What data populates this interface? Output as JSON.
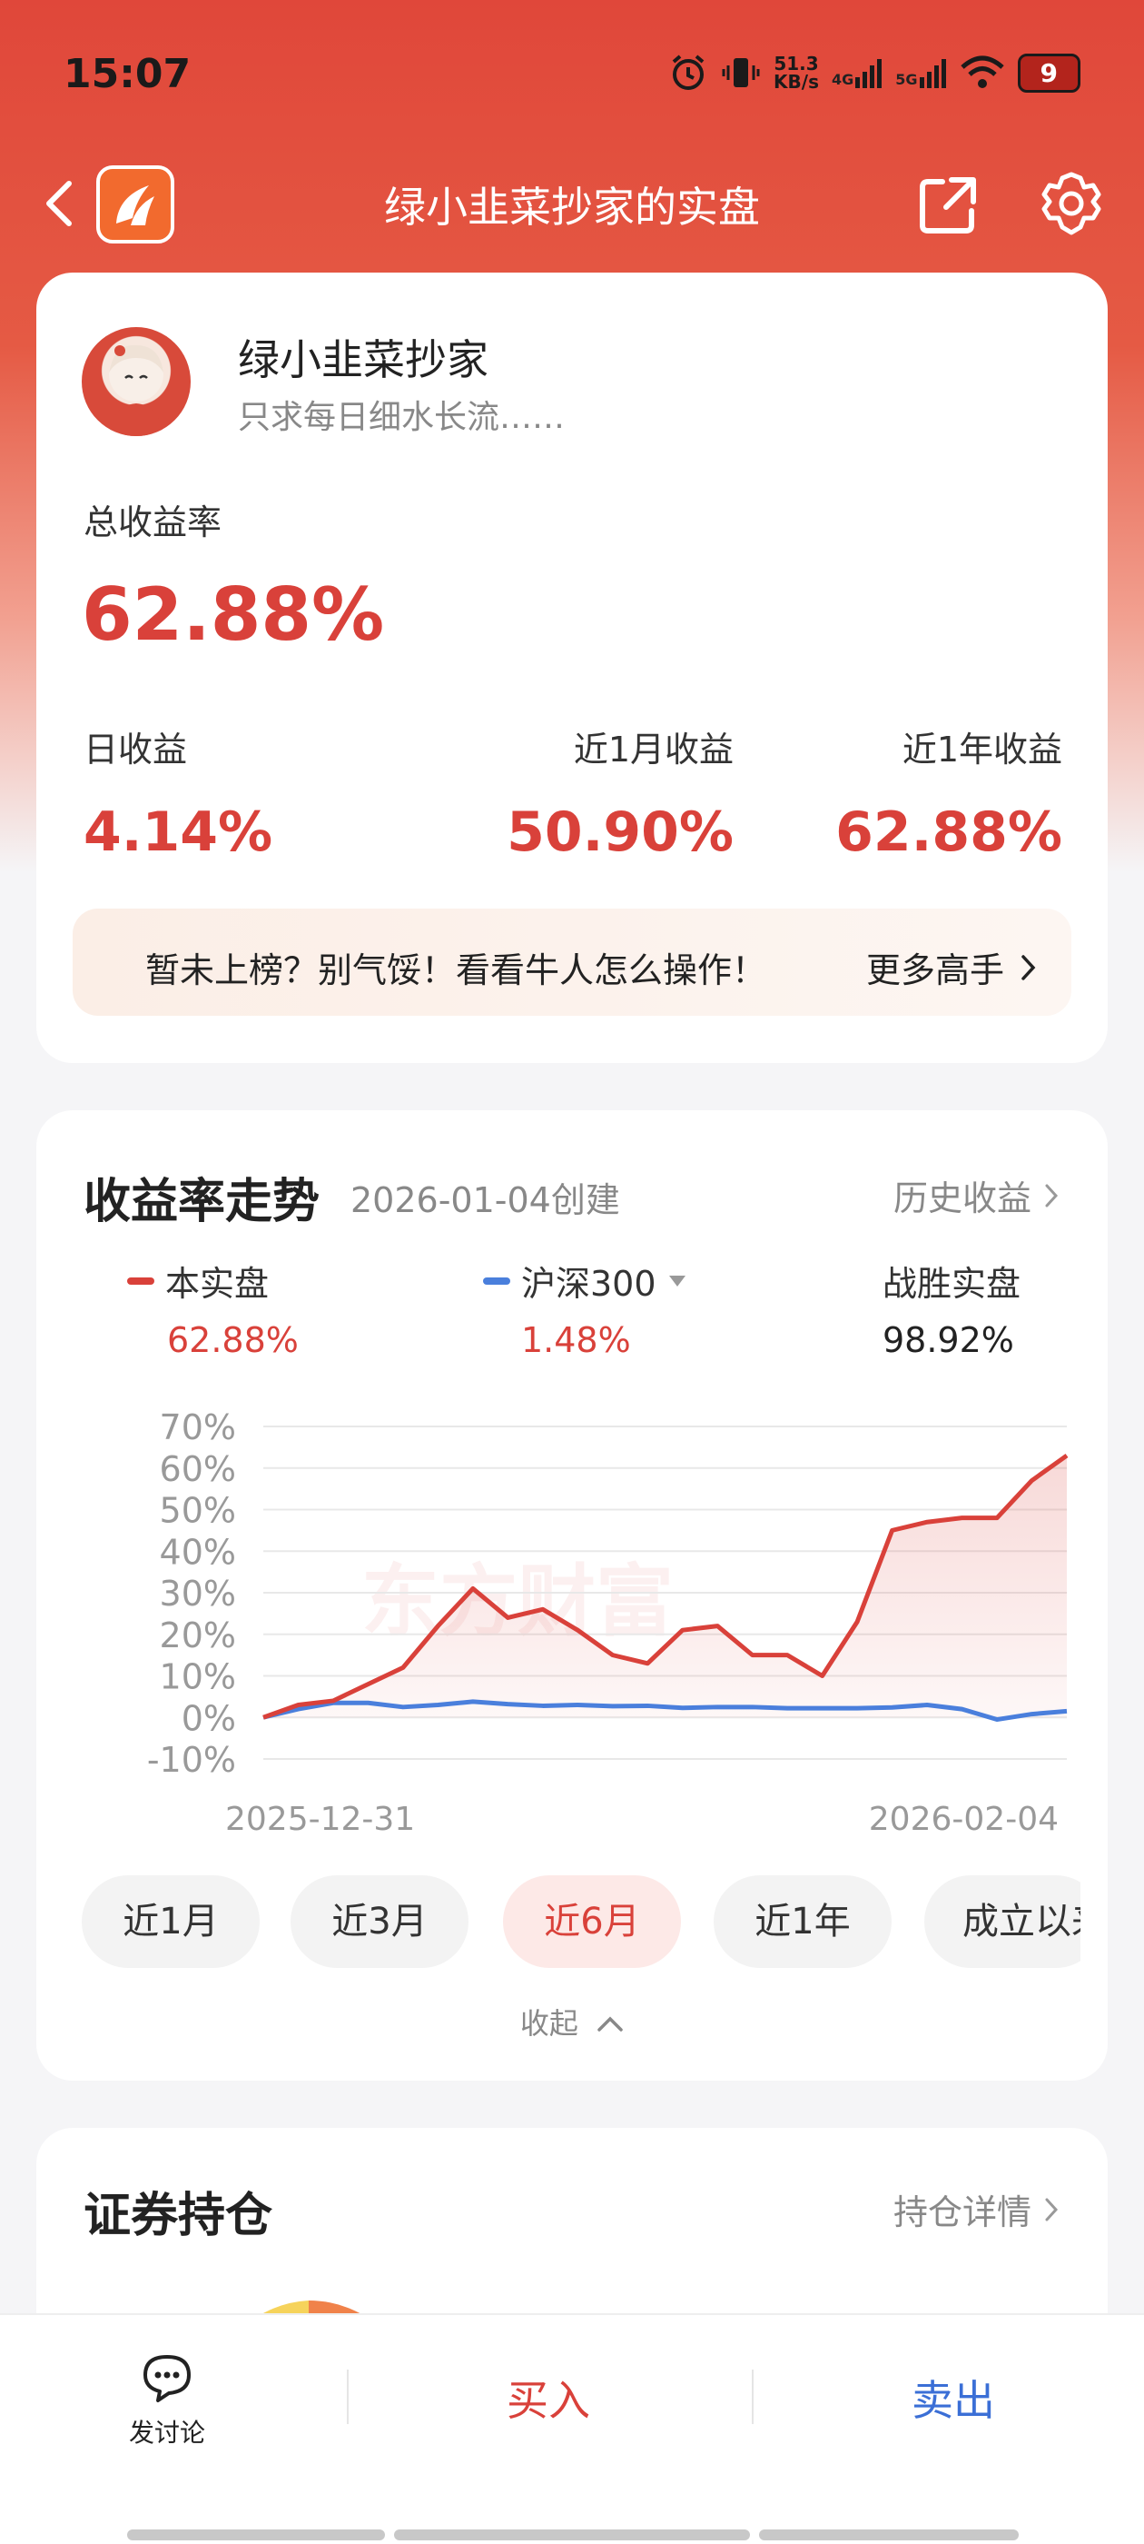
{
  "status": {
    "time": "15:07",
    "net_speed_top": "51.3",
    "net_speed_bottom": "KB/s",
    "signal1": "4G",
    "signal2": "5G",
    "battery": "9"
  },
  "nav": {
    "title": "绿小韭菜抄家的实盘"
  },
  "profile": {
    "name": "绿小韭菜抄家",
    "signature": "只求每日细水长流……",
    "total_label": "总收益率",
    "total_value": "62.88%",
    "stats": [
      {
        "label": "日收益",
        "value": "4.14%"
      },
      {
        "label": "近1月收益",
        "value": "50.90%"
      },
      {
        "label": "近1年收益",
        "value": "62.88%"
      }
    ],
    "promo_text": "暂未上榜？别气馁！看看牛人怎么操作！",
    "promo_more": "更多高手"
  },
  "trend": {
    "title": "收益率走势",
    "created": "2026-01-04创建",
    "history_link": "历史收益",
    "legend": [
      {
        "name": "本实盘",
        "value": "62.88%",
        "color": "#d9413a"
      },
      {
        "name": "沪深300",
        "value": "1.48%",
        "color": "#4a7fdc"
      },
      {
        "name": "战胜实盘",
        "value": "98.92%"
      }
    ],
    "ranges": [
      "近1月",
      "近3月",
      "近6月",
      "近1年",
      "成立以来"
    ],
    "active_range": "近6月",
    "collapse": "收起"
  },
  "chart_data": {
    "type": "line",
    "x_start": "2025-12-31",
    "x_end": "2026-02-04",
    "yticks": [
      "70%",
      "60%",
      "50%",
      "40%",
      "30%",
      "20%",
      "10%",
      "0%",
      "-10%"
    ],
    "ylim": [
      -10,
      70
    ],
    "series": [
      {
        "name": "本实盘",
        "color": "#d9413a",
        "values": [
          0,
          3,
          4,
          8,
          12,
          22,
          31,
          24,
          26,
          21,
          15,
          13,
          21,
          22,
          15,
          15,
          10,
          23,
          45,
          47,
          48,
          48,
          57,
          63
        ]
      },
      {
        "name": "沪深300",
        "color": "#4a7fdc",
        "values": [
          0,
          2,
          3.5,
          3.5,
          2.5,
          3,
          3.8,
          3.2,
          2.8,
          3,
          2.7,
          2.8,
          2.3,
          2.5,
          2.5,
          2.2,
          2.2,
          2.2,
          2.4,
          3,
          2,
          -0.5,
          0.8,
          1.5
        ]
      }
    ]
  },
  "watermark": "东方财富",
  "holdings": {
    "title": "证券持仓",
    "detail_link": "持仓详情"
  },
  "bottom": {
    "discuss": "发讨论",
    "buy": "买入",
    "sell": "卖出"
  }
}
